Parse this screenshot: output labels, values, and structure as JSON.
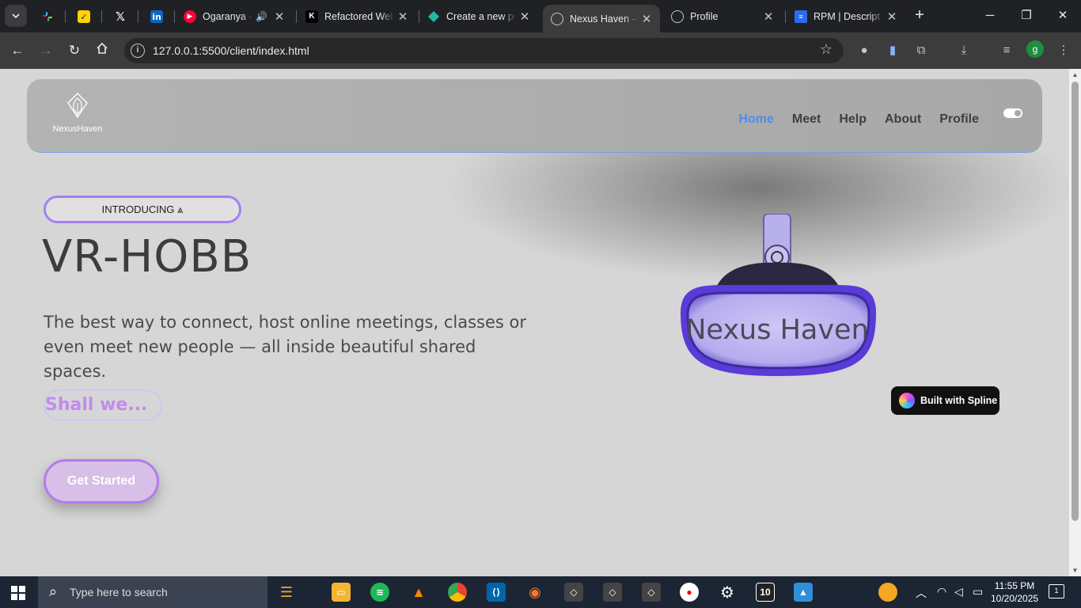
{
  "browser": {
    "pinned_tabs": [
      {
        "name": "slack-icon",
        "color": "#4a154b"
      },
      {
        "name": "norton-icon",
        "color": "#ffd200"
      },
      {
        "name": "x-icon",
        "color": "#000000"
      },
      {
        "name": "linkedin-icon",
        "color": "#0a66c2"
      }
    ],
    "tabs": [
      {
        "title": "Ogaranya -",
        "icon": "youtube-music-icon",
        "active": false
      },
      {
        "title": "Refactored Web",
        "icon": "k-icon",
        "active": false
      },
      {
        "title": "Create a new pr",
        "icon": "diamond-icon",
        "active": false
      },
      {
        "title": "Nexus Haven – ",
        "icon": "globe-icon",
        "active": true
      },
      {
        "title": "Profile",
        "icon": "globe-icon",
        "active": false
      },
      {
        "title": "RPM | Descript",
        "icon": "descript-icon",
        "active": false
      }
    ],
    "url": "127.0.0.1:5500/client/index.html",
    "profile_initial": "g"
  },
  "site": {
    "logo_text": "NexusHaven",
    "nav": [
      "Home",
      "Meet",
      "Help",
      "About",
      "Profile"
    ],
    "active_nav": "Home",
    "intro_pill": "INTRODUCING ⩓",
    "hero_title": "VR-HOBB",
    "hero_description": "The best way to connect, host online meetings, classes or even meet new people — all inside beautiful shared spaces.",
    "shall_we": "Shall we...",
    "cta_label": "Get Started",
    "headset_text": "Nexus Haven",
    "spline_badge": "Built with Spline"
  },
  "taskbar": {
    "search_placeholder": "Type here to search",
    "time": "11:55 PM",
    "date": "10/20/2025",
    "notification_count": "1",
    "pinned_badge": "10"
  },
  "colors": {
    "accent_blue": "#4a8ef0",
    "accent_purple": "#a47ff5",
    "cta_fill": "#d8bfe8"
  }
}
